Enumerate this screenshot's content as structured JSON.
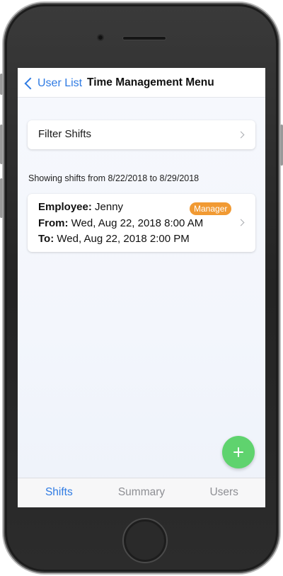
{
  "nav": {
    "back_label": "User List",
    "title": "Time Management Menu"
  },
  "filter": {
    "label": "Filter Shifts"
  },
  "range_text": "Showing shifts from 8/22/2018 to 8/29/2018",
  "shifts": [
    {
      "employee_label": "Employee:",
      "employee_name": "Jenny",
      "role_badge": "Manager",
      "from_label": "From:",
      "from_value": "Wed, Aug 22, 2018 8:00 AM",
      "to_label": "To:",
      "to_value": "Wed, Aug 22, 2018 2:00 PM"
    }
  ],
  "fab": {
    "icon": "plus-icon"
  },
  "tabs": [
    {
      "label": "Shifts",
      "active": true
    },
    {
      "label": "Summary",
      "active": false
    },
    {
      "label": "Users",
      "active": false
    }
  ],
  "colors": {
    "accent": "#2f7be3",
    "badge": "#f19a33",
    "fab": "#5fd36e",
    "tab_inactive": "#8e8f94"
  }
}
